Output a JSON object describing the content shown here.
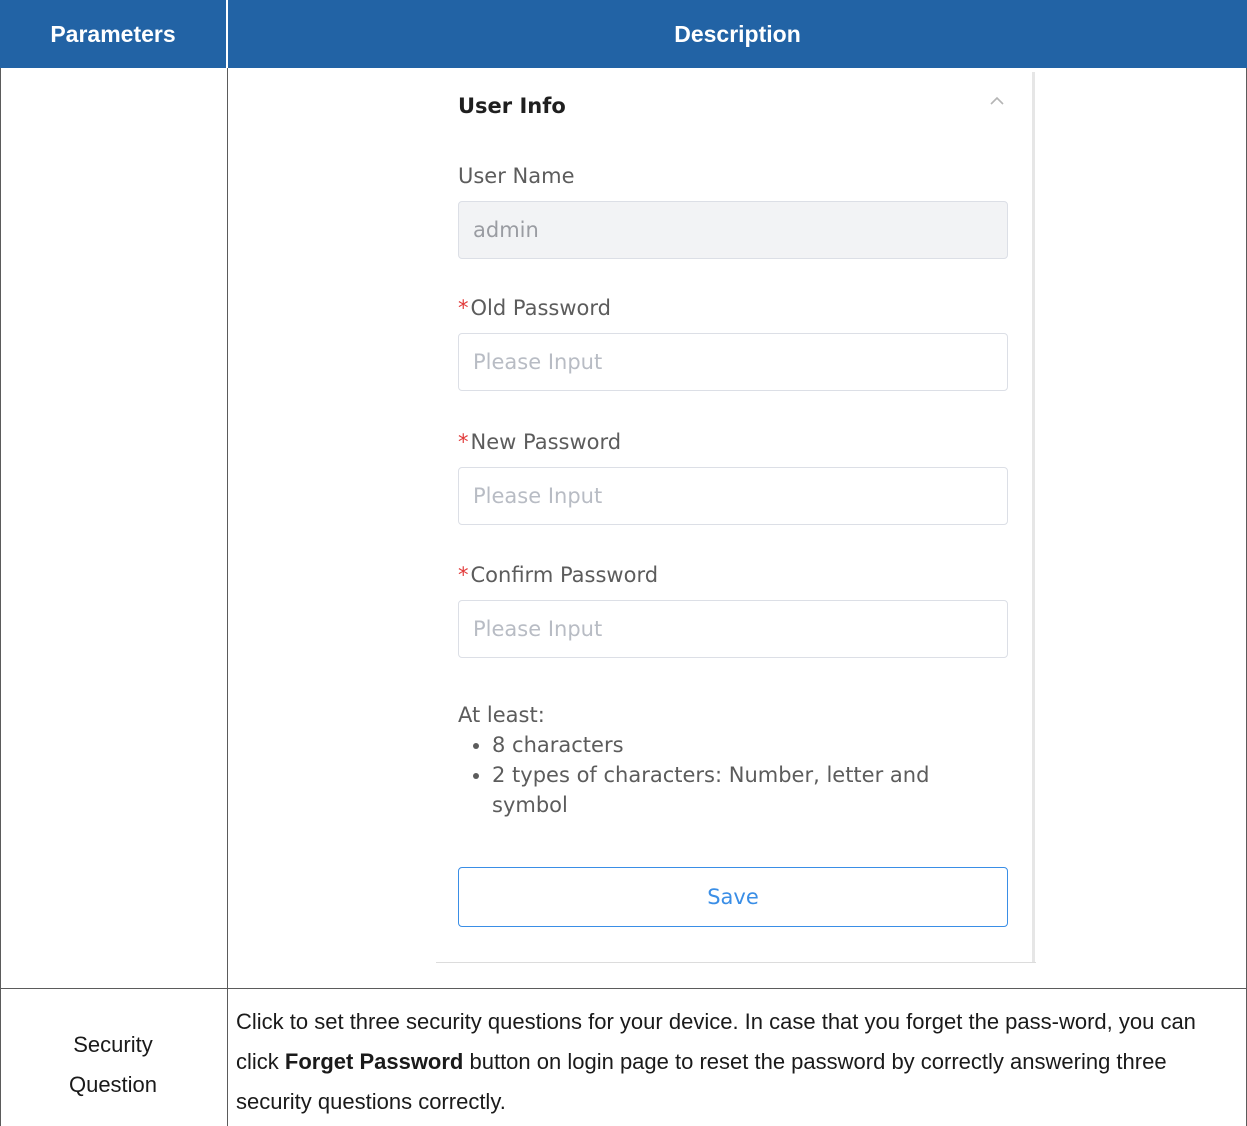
{
  "table": {
    "headers": {
      "parameters": "Parameters",
      "description": "Description"
    }
  },
  "user_info_panel": {
    "title": "User Info",
    "collapse_icon": "chevron-up-icon",
    "user_name": {
      "label": "User Name",
      "value": "admin"
    },
    "old_password": {
      "required_mark": "*",
      "label": "Old Password",
      "placeholder": "Please Input"
    },
    "new_password": {
      "required_mark": "*",
      "label": "New Password",
      "placeholder": "Please Input"
    },
    "confirm_password": {
      "required_mark": "*",
      "label": "Confirm Password",
      "placeholder": "Please Input"
    },
    "hint": {
      "intro": "At least:",
      "rules": [
        "8 characters",
        "2 types of characters: Number, letter and symbol"
      ]
    },
    "save_label": "Save",
    "colors": {
      "accent": "#3a8ee6",
      "required": "#e23b3b"
    }
  },
  "security_question_row": {
    "param_line1": "Security",
    "param_line2": "Question",
    "desc_before": "Click to set three security questions for your device. In case that you forget the pass-word, you can click ",
    "desc_bold": "Forget Password",
    "desc_after": " button on login page to reset the password by correctly answering three security questions correctly."
  },
  "colors": {
    "header_bg": "#2263a5",
    "header_text": "#ffffff"
  }
}
